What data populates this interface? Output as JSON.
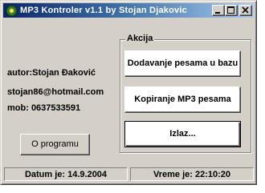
{
  "window": {
    "title": "MP3 Kontroler  v1.1   by Stojan Djakovic"
  },
  "info": {
    "author": "autor:Stojan Đaković",
    "email": "stojan86@hotmail.com",
    "phone": "mob:  0637533591"
  },
  "buttons": {
    "about": "O programu",
    "add_songs": "Dodavanje pesama u bazu",
    "copy_mp3": "Kopiranje MP3 pesama",
    "exit": "Izlaz..."
  },
  "group": {
    "title": "Akcija"
  },
  "status": {
    "date": "Datum je: 14.9.2004",
    "time": "Vreme je: 22:10:20"
  },
  "icons": {
    "app": "mp3-app-icon",
    "minimize": "minimize-icon",
    "maximize": "maximize-icon",
    "close": "close-icon"
  },
  "colors": {
    "titlebar_start": "#0a246a",
    "titlebar_end": "#a6caf0",
    "face": "#d4d0c8"
  }
}
